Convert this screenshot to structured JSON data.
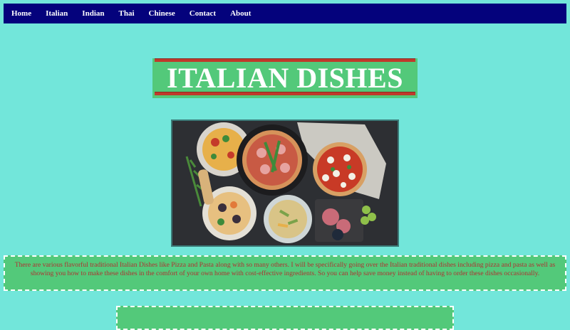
{
  "nav": {
    "items": [
      "Home",
      "Italian",
      "Indian",
      "Thai",
      "Chinese",
      "Contact",
      "About"
    ]
  },
  "page": {
    "title": "ITALIAN DISHES"
  },
  "hero": {
    "alt": "Assorted Italian dishes including pizza and pasta on a dark table"
  },
  "intro": {
    "text": "There are various flavorful traditional Italian Dishes like Pizza and Pasta along with so many others. I will be specifically going over the Italian traditional dishes including pizza and pasta as well as showing you how to make these dishes in the comfort of your own home with cost-effective ingredients. So you can help save money instead of having to order these dishes occasionally."
  },
  "colors": {
    "background": "#72e6da",
    "navbar": "#04027c",
    "panel": "#53c97a",
    "accent_rule": "#c0392b",
    "body_text": "#b03030"
  }
}
